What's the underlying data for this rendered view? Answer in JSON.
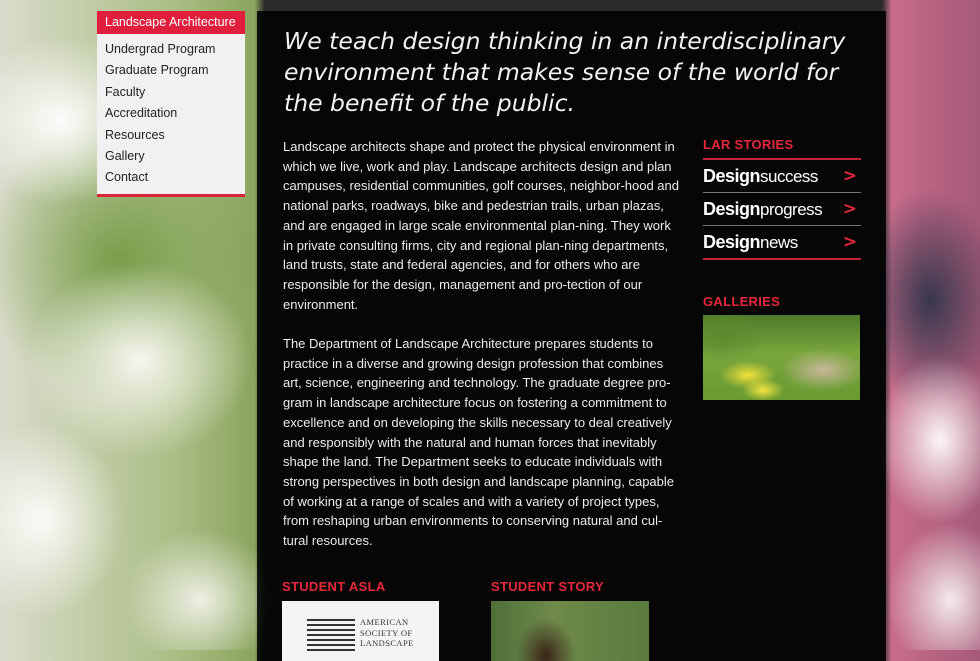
{
  "nav": {
    "active": "Landscape Architecture",
    "items": [
      "Undergrad Program",
      "Graduate Program",
      "Faculty",
      "Accreditation",
      "Resources",
      "Gallery",
      "Contact"
    ]
  },
  "main": {
    "tagline": "We teach design thinking in an interdisciplinary environment that makes sense of the world for the benefit of the public.",
    "paragraphs": [
      "Landscape architects shape and protect the physical environment in which we live, work and play. Landscape architects design and plan campuses, residential communities, golf courses, neighbor-hood and national parks, roadways, bike and pedestrian trails, urban plazas, and are engaged in large scale environmental plan-ning. They work in private consulting firms, city and regional plan-ning departments, land trusts, state and federal agencies, and for others who are responsible for the design, management and pro-tection of our environment.",
      "The Department of Landscape Architecture prepares students to practice in a diverse and growing design profession that combines art, science, engineering and technology. The graduate degree pro-gram in landscape architecture focus on fostering a commitment to excellence and on developing the skills necessary to deal creatively and responsibly with the natural and human forces that inevitably shape the land. The Department seeks to educate individuals with strong perspectives in both design and landscape planning, capable of working at a range of scales and with a variety of project types, from reshaping urban environments to conserving natural and cul-tural resources."
    ]
  },
  "sidebar": {
    "stories_heading": "LAR STORIES",
    "stories": [
      {
        "word": "Design",
        "sub": "success",
        "arrow": ">"
      },
      {
        "word": "Design",
        "sub": "progress",
        "arrow": ">"
      },
      {
        "word": "Design",
        "sub": "news",
        "arrow": ">"
      }
    ],
    "galleries_heading": "GALLERIES"
  },
  "bottom": {
    "asla_heading": "STUDENT ASLA",
    "asla_logo_text": [
      "AMERICAN",
      "SOCIETY OF",
      "LANDSCAPE"
    ],
    "story_heading": "STUDENT STORY"
  },
  "colors": {
    "accent": "#e01f3d",
    "panel": "#000000",
    "nav_bg": "#f1f1f1"
  }
}
